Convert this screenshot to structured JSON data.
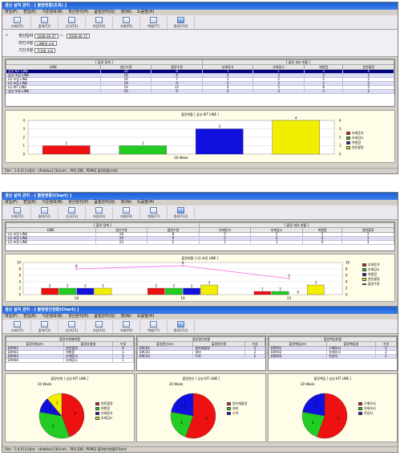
{
  "w1": {
    "title": "생산 실적 관리  - [ 불량현황(조회) ]",
    "menu": [
      "파일(F)",
      "편집(E)",
      "기준정보(B)",
      "생산관리(P)",
      "품질관리(Q)",
      "창(W)",
      "도움말(H)"
    ],
    "toolbar": [
      "조회(F5)",
      "출력(F2)",
      "신규(F3)",
      "저장(F4)",
      "삭제(F6)",
      "엑셀(F7)",
      "종료(F12)"
    ],
    "params": {
      "period_label": "생산일자",
      "date_from": "2008-06-07",
      "date_to": "2008-06-15",
      "group_label": "라인구분",
      "group_value": "LINE별 조회",
      "kind_label": "기간구분",
      "kind_value": "주차별 조회"
    },
    "grid": {
      "section_a": "[ 불량 합계 ]",
      "section_b": "[ 불량 세부 현황 ]",
      "headers": [
        "LINE",
        "생산수량",
        "불량수량",
        "부재증가",
        "부재감소",
        "위험함",
        "원천불량"
      ],
      "rows": [
        [
          "삼성 KIT LINE",
          "20",
          "8",
          "1",
          "1",
          "3",
          "4"
        ],
        [
          "삼성 조립 LINE",
          "18",
          "9",
          "2",
          "3",
          "2",
          "2"
        ],
        [
          "LG 조립 LINE",
          "16",
          "7",
          "1",
          "2",
          "2",
          "2"
        ],
        [
          "LG 포장 LINE",
          "19",
          "9",
          "2",
          "3",
          "2",
          "2"
        ],
        [
          "LG KIT LINE",
          "19",
          "22",
          "4",
          "5",
          "8",
          "5"
        ],
        [
          "삼성 포장 LINE",
          "19",
          "9",
          "2",
          "3",
          "2",
          "2"
        ]
      ]
    },
    "chart_data": {
      "type": "bar",
      "title": "불량현황 [ 삼성 KIT LINE ]",
      "categories": [
        "부재증가",
        "부재감소",
        "위험함",
        "원천불량"
      ],
      "values": [
        1,
        1,
        3,
        4
      ],
      "colors": [
        "#ee1111",
        "#22cc22",
        "#1111dd",
        "#f2ee00"
      ],
      "xlabel": "20 Week",
      "ylim": [
        0,
        4
      ],
      "yticks": [
        "0",
        "1",
        "2",
        "3",
        "4"
      ]
    },
    "status": "[Ver : 1.0.0]  [사용자 : sfmbdus]  [회사코드 : PIS]  [DB : PEMS]  불량현황(조회)"
  },
  "w2": {
    "title": "생산 실적 관리  - [ 불량현황(Chart) ]",
    "menu": [
      "파일(F)",
      "편집(E)",
      "기준정보(B)",
      "생산관리(P)",
      "품질관리(Q)",
      "창(W)",
      "도움말(H)"
    ],
    "toolbar": [
      "조회(F5)",
      "출력(F2)",
      "신규(F3)",
      "저장(F4)",
      "삭제(F6)",
      "엑셀(F7)",
      "종료(F12)"
    ],
    "grid": {
      "section_a": "[ 불량 합계 ]",
      "section_b": "[ 불량 세부 현황 ]",
      "headers": [
        "LINE",
        "생산수량",
        "불량수량",
        "부재증가",
        "부재감소",
        "위험함",
        "원천불량"
      ],
      "rows": [
        [
          "LG 포장 LINE",
          "18",
          "8",
          "2",
          "2",
          "2",
          "2"
        ],
        [
          "LG 포장 LINE",
          "19",
          "9",
          "2",
          "2",
          "2",
          "3"
        ],
        [
          "LG 포장 LINE",
          "23",
          "5",
          "1",
          "1",
          "0",
          "3"
        ]
      ]
    },
    "chart_data": {
      "type": "bar",
      "title": "불량현황 [ LG 포장 LINE ]",
      "categories": [
        "18",
        "19",
        "23"
      ],
      "series": [
        {
          "name": "부재증가",
          "color": "#ee1111",
          "values": [
            2,
            2,
            1
          ]
        },
        {
          "name": "부재감소",
          "color": "#22cc22",
          "values": [
            2,
            2,
            1
          ]
        },
        {
          "name": "위험함",
          "color": "#1111dd",
          "values": [
            2,
            2,
            0
          ]
        },
        {
          "name": "원천불량",
          "color": "#f2ee00",
          "values": [
            2,
            3,
            3
          ]
        },
        {
          "name": "불량수량",
          "color": "#ee66ee",
          "type": "line",
          "values": [
            8,
            9,
            5
          ]
        }
      ],
      "ylim": [
        0,
        10
      ],
      "yticks": [
        "0",
        "2",
        "4",
        "6",
        "8",
        "10"
      ]
    },
    "status": "[Ver : 1.0.0]  [사용자 : sfmbdus]  [회사코드 : PIS]  [DB : PEMS]  불량현황(Chart)"
  },
  "w3": {
    "title": "생산 실적 관리  - [ 불량원인현황(Chart) ]",
    "menu": [
      "파일(F)",
      "편집(E)",
      "기준정보(B)",
      "생산관리(P)",
      "품질관리(Q)",
      "창(W)",
      "도움말(H)"
    ],
    "toolbar": [
      "조회(F5)",
      "출력(F2)",
      "신규(F3)",
      "저장(F4)",
      "삭제(F6)",
      "엑셀(F7)",
      "종료(F12)"
    ],
    "tables": [
      {
        "caption": "불량유형별현황",
        "headers": [
          "불량유형코드",
          "불량유형명",
          "수량"
        ],
        "rows": [
          [
            "ERA01",
            "원천불량",
            "4"
          ],
          [
            "ERA02",
            "위험함",
            "3"
          ],
          [
            "ERA03",
            "부재증가",
            "1"
          ],
          [
            "ERA04",
            "부재감소",
            "1"
          ]
        ]
      },
      {
        "caption": "불량원인현황",
        "headers": [
          "불량원인코드",
          "불량원인명",
          "수량"
        ],
        "rows": [
          [
            "ERC01",
            "원자재불량",
            "5"
          ],
          [
            "ERC02",
            "설비",
            "2"
          ],
          [
            "ERC03",
            "누락",
            "2"
          ]
        ]
      },
      {
        "caption": "불량책임현황",
        "headers": [
          "불량책임코드",
          "불량책임명",
          "수량"
        ],
        "rows": [
          [
            "ERR01",
            "구매부서",
            "5"
          ],
          [
            "ERR02",
            "자재부서",
            "2"
          ],
          [
            "ERR03",
            "작업자",
            "2"
          ]
        ]
      }
    ],
    "chart_data": [
      {
        "type": "pie",
        "title": "불량유형 [ 삼성 KIT LINE ]",
        "subtitle": "20 Week",
        "categories": [
          "원천불량",
          "위험함",
          "부재증가",
          "부재감소"
        ],
        "values": [
          4,
          3,
          1,
          1
        ],
        "colors": [
          "#ee1111",
          "#22cc22",
          "#1111dd",
          "#f2ee00"
        ]
      },
      {
        "type": "pie",
        "title": "불량원인 [ 삼성 KIT LINE ]",
        "subtitle": "20 Week",
        "categories": [
          "원자재불량",
          "설비",
          "누락"
        ],
        "values": [
          5,
          2,
          2
        ],
        "colors": [
          "#ee1111",
          "#22cc22",
          "#1111dd"
        ]
      },
      {
        "type": "pie",
        "title": "불량책임 [ 삼성 KIT LINE ]",
        "subtitle": "20 Week",
        "categories": [
          "구매부서",
          "자재부서",
          "작업자"
        ],
        "values": [
          5,
          2,
          2
        ],
        "colors": [
          "#ee1111",
          "#22cc22",
          "#1111dd"
        ]
      }
    ],
    "status": "[Ver : 1.0.0]  [사용자 : sfmbdus]  [회사코드 : PIS]  [DB : PEMS]  불량원인현황(Chart)"
  }
}
